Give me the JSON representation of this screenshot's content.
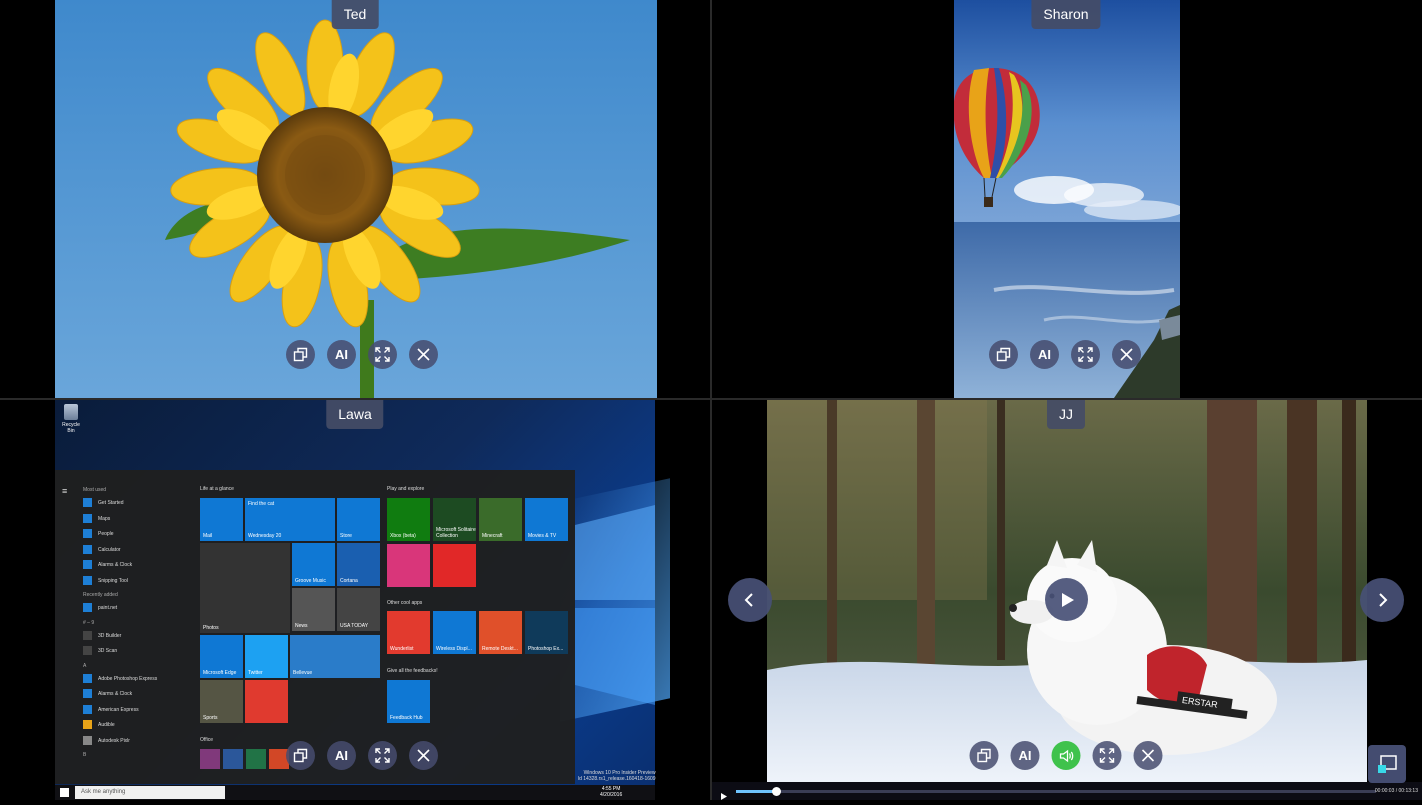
{
  "tiles": [
    {
      "name": "Ted"
    },
    {
      "name": "Sharon"
    },
    {
      "name": "Lawa"
    },
    {
      "name": "JJ"
    }
  ],
  "controls": {
    "window_icon": "restore-window-icon",
    "ai_label": "AI",
    "expand_icon": "expand-icon",
    "close_icon": "close-icon",
    "volume_icon": "speaker-icon"
  },
  "desktop": {
    "recycle_bin": "Recycle Bin",
    "most_used": "Most used",
    "most_used_items": [
      "Get Started",
      "Maps",
      "People",
      "Calculator",
      "Alarms & Clock",
      "Snipping Tool"
    ],
    "recently_added": "Recently added",
    "recently_added_items": [
      "paint.net"
    ],
    "section_0_9": "# – 9",
    "section_0_9_items": [
      "3D Builder",
      "3D Scan"
    ],
    "section_a": "A",
    "section_a_items": [
      "Adobe Photoshop Express",
      "Alarms & Clock",
      "American Express",
      "Audible",
      "Autodesk Pixlr"
    ],
    "section_b": "B",
    "group_life": "Life at a glance",
    "group_play": "Play and explore",
    "group_cool": "Other cool apps",
    "group_feedback": "Give all the feedbacks!",
    "group_office": "Office",
    "tile_labels": {
      "mail": "Mail",
      "wednesday": "Wednesday 20",
      "find_cat": "Find the cat",
      "store": "Store",
      "photos": "Photos",
      "groove": "Groove Music",
      "cortana": "Cortana",
      "news": "News",
      "usa_today": "USA TODAY",
      "edge": "Microsoft Edge",
      "twitter": "Twitter",
      "bellevue": "Bellevue",
      "sports": "Sports",
      "xbox": "Xbox (beta)",
      "solitaire": "Microsoft Solitaire Collection",
      "minecraft": "Minecraft",
      "movies": "Movies & TV",
      "wunderlist": "Wunderlist",
      "wireless": "Wireless Displ...",
      "remote": "Remote Deskt...",
      "photoshop": "Photoshop Ex...",
      "feedback": "Feedback Hub"
    },
    "search_placeholder": "Ask me anything",
    "clock_time": "4:55 PM",
    "clock_date": "4/20/2016",
    "watermark_line1": "Windows 10 Pro Insider Preview",
    "watermark_line2": "ld 14328.rs1_release.160418-1609"
  },
  "media": {
    "current_time": "00:00:03",
    "duration": "00:13:13",
    "progress": 0.063
  },
  "colors": {
    "control_bg": "#464c6e",
    "volume_active": "#3fc24c",
    "progress_fill": "#6fc4ff"
  }
}
